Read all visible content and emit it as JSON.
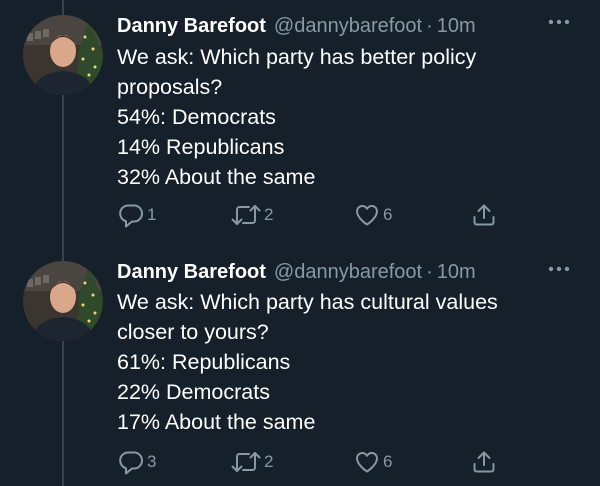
{
  "colors": {
    "background": "#15202b",
    "text": "#ffffff",
    "secondary": "#8899a6",
    "thread_line": "#38444d"
  },
  "tweets": [
    {
      "name": "Danny Barefoot",
      "handle": "@dannybarefoot",
      "separator": "·",
      "time": "10m",
      "lines": [
        "We ask: Which party has better policy",
        "proposals?",
        "54%: Democrats",
        "14% Republicans",
        "32% About the same"
      ],
      "replies": "1",
      "retweets": "2",
      "likes": "6",
      "icons": [
        "reply-icon",
        "retweet-icon",
        "like-icon",
        "share-icon",
        "more-icon"
      ]
    },
    {
      "name": "Danny Barefoot",
      "handle": "@dannybarefoot",
      "separator": "·",
      "time": "10m",
      "lines": [
        "We ask: Which party has cultural values",
        "closer to yours?",
        "61%: Republicans",
        "22% Democrats",
        "17% About the same"
      ],
      "replies": "3",
      "retweets": "2",
      "likes": "6",
      "icons": [
        "reply-icon",
        "retweet-icon",
        "like-icon",
        "share-icon",
        "more-icon"
      ]
    }
  ]
}
